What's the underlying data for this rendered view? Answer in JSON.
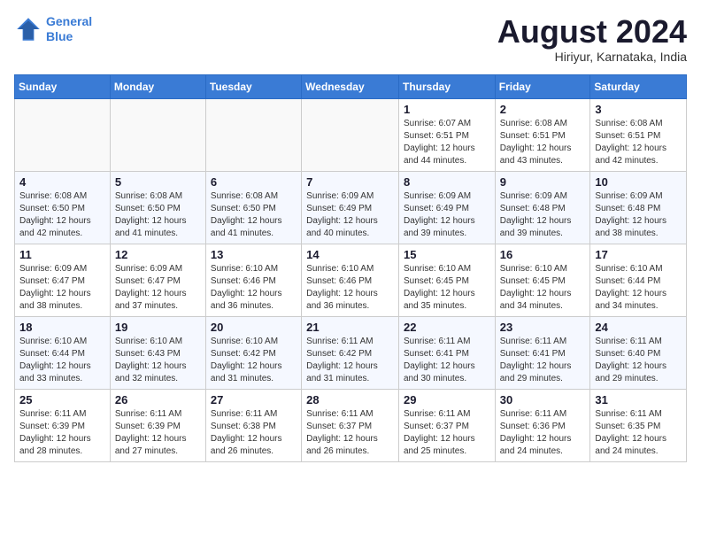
{
  "logo": {
    "line1": "General",
    "line2": "Blue"
  },
  "title": "August 2024",
  "location": "Hiriyur, Karnataka, India",
  "days_of_week": [
    "Sunday",
    "Monday",
    "Tuesday",
    "Wednesday",
    "Thursday",
    "Friday",
    "Saturday"
  ],
  "weeks": [
    [
      {
        "num": "",
        "info": ""
      },
      {
        "num": "",
        "info": ""
      },
      {
        "num": "",
        "info": ""
      },
      {
        "num": "",
        "info": ""
      },
      {
        "num": "1",
        "info": "Sunrise: 6:07 AM\nSunset: 6:51 PM\nDaylight: 12 hours\nand 44 minutes."
      },
      {
        "num": "2",
        "info": "Sunrise: 6:08 AM\nSunset: 6:51 PM\nDaylight: 12 hours\nand 43 minutes."
      },
      {
        "num": "3",
        "info": "Sunrise: 6:08 AM\nSunset: 6:51 PM\nDaylight: 12 hours\nand 42 minutes."
      }
    ],
    [
      {
        "num": "4",
        "info": "Sunrise: 6:08 AM\nSunset: 6:50 PM\nDaylight: 12 hours\nand 42 minutes."
      },
      {
        "num": "5",
        "info": "Sunrise: 6:08 AM\nSunset: 6:50 PM\nDaylight: 12 hours\nand 41 minutes."
      },
      {
        "num": "6",
        "info": "Sunrise: 6:08 AM\nSunset: 6:50 PM\nDaylight: 12 hours\nand 41 minutes."
      },
      {
        "num": "7",
        "info": "Sunrise: 6:09 AM\nSunset: 6:49 PM\nDaylight: 12 hours\nand 40 minutes."
      },
      {
        "num": "8",
        "info": "Sunrise: 6:09 AM\nSunset: 6:49 PM\nDaylight: 12 hours\nand 39 minutes."
      },
      {
        "num": "9",
        "info": "Sunrise: 6:09 AM\nSunset: 6:48 PM\nDaylight: 12 hours\nand 39 minutes."
      },
      {
        "num": "10",
        "info": "Sunrise: 6:09 AM\nSunset: 6:48 PM\nDaylight: 12 hours\nand 38 minutes."
      }
    ],
    [
      {
        "num": "11",
        "info": "Sunrise: 6:09 AM\nSunset: 6:47 PM\nDaylight: 12 hours\nand 38 minutes."
      },
      {
        "num": "12",
        "info": "Sunrise: 6:09 AM\nSunset: 6:47 PM\nDaylight: 12 hours\nand 37 minutes."
      },
      {
        "num": "13",
        "info": "Sunrise: 6:10 AM\nSunset: 6:46 PM\nDaylight: 12 hours\nand 36 minutes."
      },
      {
        "num": "14",
        "info": "Sunrise: 6:10 AM\nSunset: 6:46 PM\nDaylight: 12 hours\nand 36 minutes."
      },
      {
        "num": "15",
        "info": "Sunrise: 6:10 AM\nSunset: 6:45 PM\nDaylight: 12 hours\nand 35 minutes."
      },
      {
        "num": "16",
        "info": "Sunrise: 6:10 AM\nSunset: 6:45 PM\nDaylight: 12 hours\nand 34 minutes."
      },
      {
        "num": "17",
        "info": "Sunrise: 6:10 AM\nSunset: 6:44 PM\nDaylight: 12 hours\nand 34 minutes."
      }
    ],
    [
      {
        "num": "18",
        "info": "Sunrise: 6:10 AM\nSunset: 6:44 PM\nDaylight: 12 hours\nand 33 minutes."
      },
      {
        "num": "19",
        "info": "Sunrise: 6:10 AM\nSunset: 6:43 PM\nDaylight: 12 hours\nand 32 minutes."
      },
      {
        "num": "20",
        "info": "Sunrise: 6:10 AM\nSunset: 6:42 PM\nDaylight: 12 hours\nand 31 minutes."
      },
      {
        "num": "21",
        "info": "Sunrise: 6:11 AM\nSunset: 6:42 PM\nDaylight: 12 hours\nand 31 minutes."
      },
      {
        "num": "22",
        "info": "Sunrise: 6:11 AM\nSunset: 6:41 PM\nDaylight: 12 hours\nand 30 minutes."
      },
      {
        "num": "23",
        "info": "Sunrise: 6:11 AM\nSunset: 6:41 PM\nDaylight: 12 hours\nand 29 minutes."
      },
      {
        "num": "24",
        "info": "Sunrise: 6:11 AM\nSunset: 6:40 PM\nDaylight: 12 hours\nand 29 minutes."
      }
    ],
    [
      {
        "num": "25",
        "info": "Sunrise: 6:11 AM\nSunset: 6:39 PM\nDaylight: 12 hours\nand 28 minutes."
      },
      {
        "num": "26",
        "info": "Sunrise: 6:11 AM\nSunset: 6:39 PM\nDaylight: 12 hours\nand 27 minutes."
      },
      {
        "num": "27",
        "info": "Sunrise: 6:11 AM\nSunset: 6:38 PM\nDaylight: 12 hours\nand 26 minutes."
      },
      {
        "num": "28",
        "info": "Sunrise: 6:11 AM\nSunset: 6:37 PM\nDaylight: 12 hours\nand 26 minutes."
      },
      {
        "num": "29",
        "info": "Sunrise: 6:11 AM\nSunset: 6:37 PM\nDaylight: 12 hours\nand 25 minutes."
      },
      {
        "num": "30",
        "info": "Sunrise: 6:11 AM\nSunset: 6:36 PM\nDaylight: 12 hours\nand 24 minutes."
      },
      {
        "num": "31",
        "info": "Sunrise: 6:11 AM\nSunset: 6:35 PM\nDaylight: 12 hours\nand 24 minutes."
      }
    ]
  ]
}
